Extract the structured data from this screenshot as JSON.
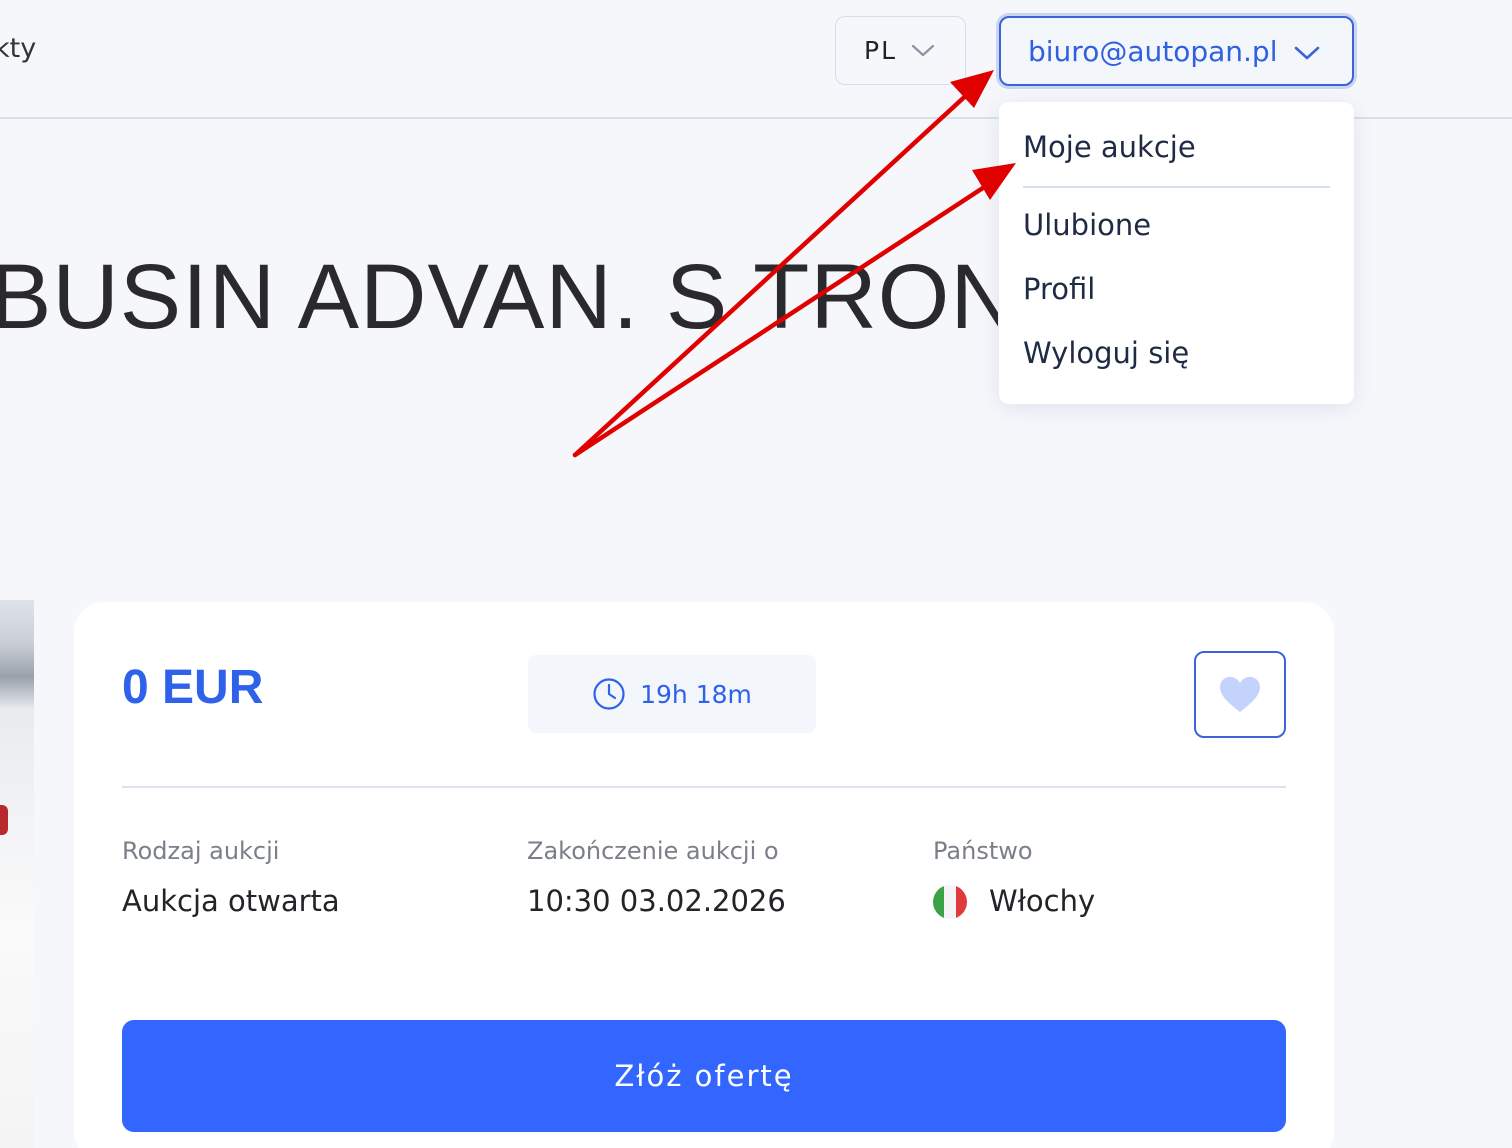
{
  "header": {
    "nav_fragment": "kty",
    "lang": "PL",
    "user_email": "biuro@autopan.pl"
  },
  "dropdown": {
    "items": [
      "Moje aukcje",
      "Ulubione",
      "Profil",
      "Wyloguj się"
    ]
  },
  "page_title": "BUSIN ADVAN. S TRON",
  "auction": {
    "price": "0 EUR",
    "timer": "19h 18m",
    "type_label": "Rodzaj aukcji",
    "type_value": "Aukcja otwarta",
    "end_label": "Zakończenie aukcji o",
    "end_value": "10:30 03.02.2026",
    "country_label": "Państwo",
    "country_value": "Włochy",
    "bid_button": "Złóż ofertę"
  },
  "icons": {
    "lang_chevron": "chevron-down-icon",
    "user_chevron": "chevron-down-icon",
    "timer_icon": "clock-icon",
    "favorite_icon": "heart-icon",
    "flag_icon": "italy-flag-icon"
  },
  "colors": {
    "accent": "#3366ff",
    "price_text": "#2f62ea",
    "annotation_arrow": "#e00000",
    "background": "#f5f7fb"
  }
}
